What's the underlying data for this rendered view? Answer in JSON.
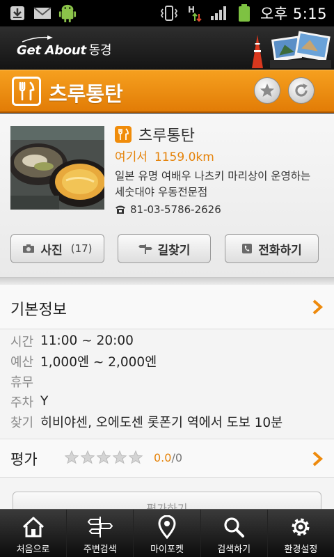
{
  "status_bar": {
    "time": "오후 5:15",
    "icons": [
      "download-icon",
      "mail-icon",
      "android-icon",
      "vibrate-icon",
      "hsdpa-data-icon",
      "signal-icon",
      "battery-icon"
    ]
  },
  "header": {
    "logo_text": "Get About",
    "city": "동경"
  },
  "title_bar": {
    "title": "츠루통탄",
    "icon": "fork-knife-icon",
    "buttons": [
      "star-icon",
      "refresh-icon"
    ]
  },
  "place": {
    "name": "츠루통탄",
    "distance_label": "여기서",
    "distance_value": "1159.0km",
    "description": "일본 유명 여배우 나츠키 마리상이 운영하는 세숫대야 우동전문점",
    "phone": "81-03-5786-2626"
  },
  "actions": {
    "photo_label": "사진",
    "photo_count": "(17)",
    "route_label": "길찾기",
    "call_label": "전화하기"
  },
  "basic_info": {
    "title": "기본정보",
    "rows": [
      {
        "label": "시간",
        "value": "11:00 ~ 20:00"
      },
      {
        "label": "예산",
        "value": "1,000엔 ~ 2,000엔"
      },
      {
        "label": "휴무",
        "value": ""
      },
      {
        "label": "주차",
        "value": "Y"
      },
      {
        "label": "찾기",
        "value": "히비야센, 오에도센 롯폰기 역에서 도보 10분"
      }
    ]
  },
  "rating": {
    "label": "평가",
    "current": "0.0",
    "total": "/0",
    "stars_filled": 0,
    "stars_total": 5
  },
  "review_button": "평가하기",
  "bottom_nav": [
    {
      "label": "처음으로",
      "icon": "home-icon"
    },
    {
      "label": "주변검색",
      "icon": "compass-icon"
    },
    {
      "label": "마이포켓",
      "icon": "map-pin-icon"
    },
    {
      "label": "검색하기",
      "icon": "search-icon"
    },
    {
      "label": "환경설정",
      "icon": "gear-icon"
    }
  ],
  "colors": {
    "accent": "#ee8a0c",
    "accent_text": "#e5830a",
    "nav_bg": "#1c1c1c"
  }
}
